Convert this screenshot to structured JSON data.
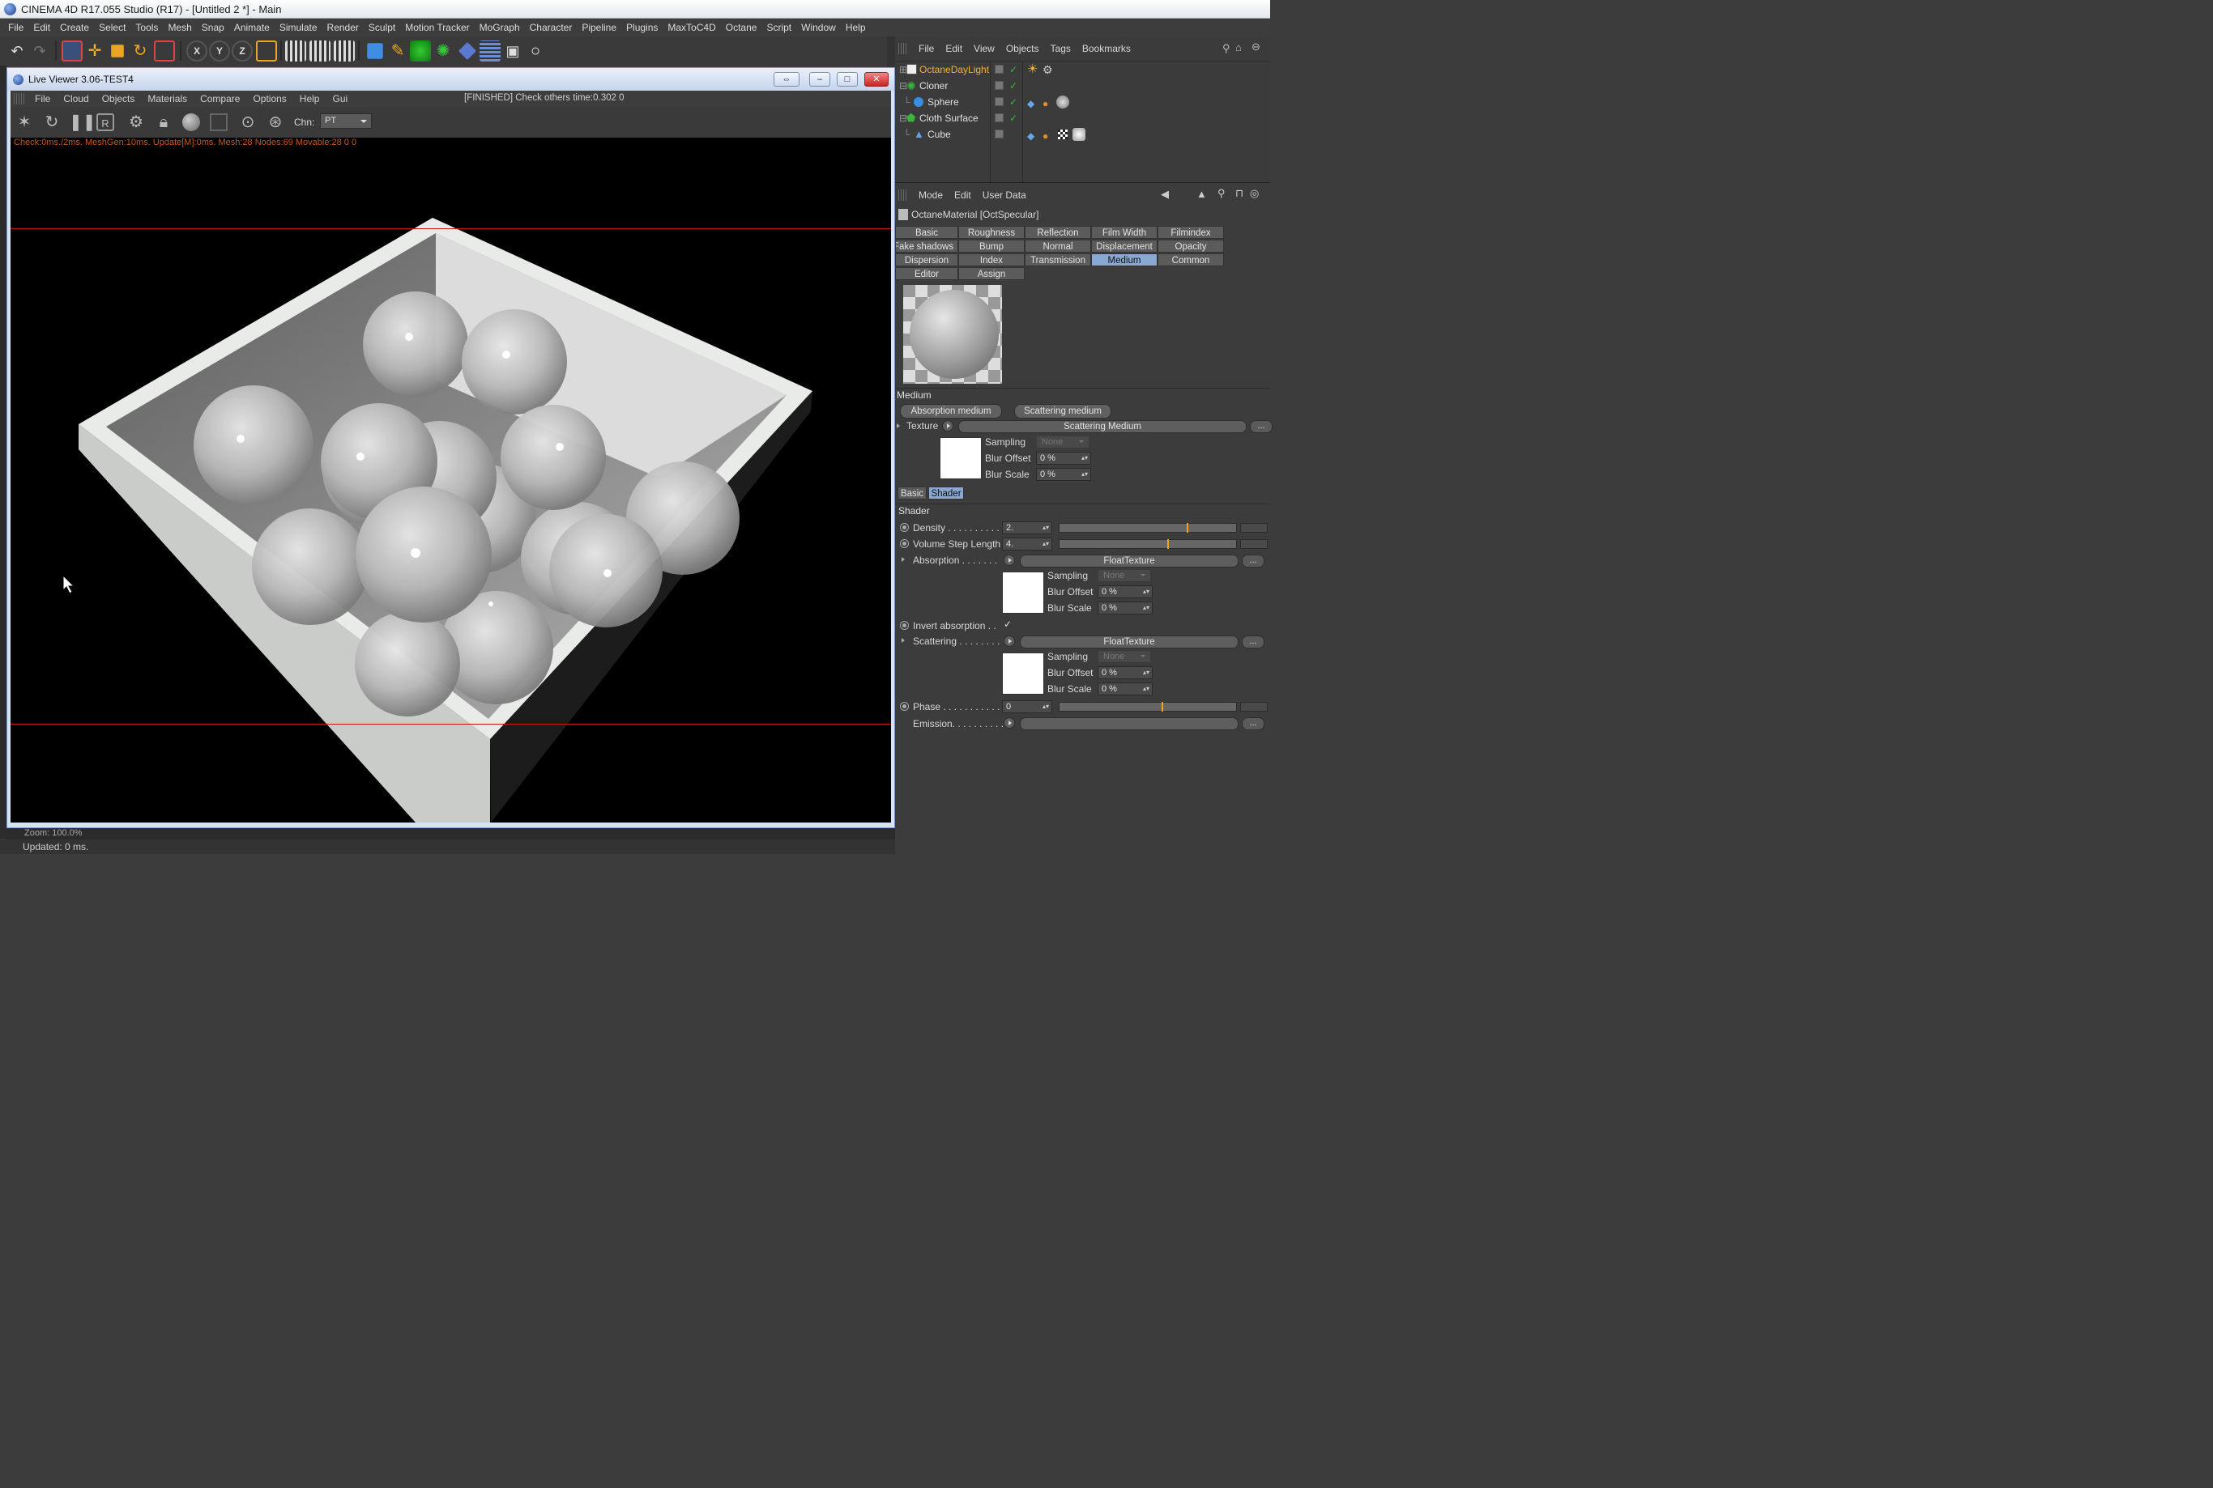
{
  "app": {
    "title": "CINEMA 4D R17.055 Studio (R17) - [Untitled 2 *] - Main",
    "menu": [
      "File",
      "Edit",
      "Create",
      "Select",
      "Tools",
      "Mesh",
      "Snap",
      "Animate",
      "Simulate",
      "Render",
      "Sculpt",
      "Motion Tracker",
      "MoGraph",
      "Character",
      "Pipeline",
      "Plugins",
      "MaxToC4D",
      "Octane",
      "Script",
      "Window",
      "Help"
    ]
  },
  "live_viewer": {
    "title": "Live Viewer 3.06-TEST4",
    "menu": [
      "File",
      "Cloud",
      "Objects",
      "Materials",
      "Compare",
      "Options",
      "Help",
      "Gui"
    ],
    "status": "[FINISHED] Check others time:0.302  0",
    "channel_label": "Chn:",
    "channel_value": "PT",
    "render_info": "Check:0ms./2ms. MeshGen:10ms. Update[M]:0ms. Mesh:28 Nodes:69 Movable:28  0 0",
    "zoom_text": "Zoom: 100.0%"
  },
  "status_bar": {
    "text": "Updated: 0 ms."
  },
  "object_manager": {
    "menu": [
      "File",
      "Edit",
      "View",
      "Objects",
      "Tags",
      "Bookmarks"
    ],
    "objects": [
      {
        "name": "OctaneDayLight",
        "active": true
      },
      {
        "name": "Cloner"
      },
      {
        "name": "Sphere"
      },
      {
        "name": "Cloth Surface"
      },
      {
        "name": "Cube"
      }
    ]
  },
  "attribute_manager": {
    "menu": [
      "Mode",
      "Edit",
      "User Data"
    ],
    "material_title": "OctaneMaterial [OctSpecular]",
    "tabs_row1": [
      "Basic",
      "Roughness",
      "Reflection",
      "Film Width",
      "Filmindex"
    ],
    "tabs_row2": [
      "Fake shadows",
      "Bump",
      "Normal",
      "Displacement",
      "Opacity"
    ],
    "tabs_row3": [
      "Dispersion",
      "Index",
      "Transmission",
      "Medium",
      "Common"
    ],
    "tabs_row4": [
      "Editor",
      "Assign"
    ],
    "selected_tab": "Medium",
    "medium_header": "Medium",
    "absorption_medium_btn": "Absorption medium",
    "scattering_medium_btn": "Scattering medium",
    "texture_label": "Texture",
    "texture_value": "Scattering Medium",
    "ellipsis": "...",
    "sampling_label": "Sampling",
    "sampling_value": "None",
    "blur_offset_label": "Blur Offset",
    "blur_offset_value": "0 %",
    "blur_scale_label": "Blur Scale",
    "blur_scale_value": "0 %",
    "subtabs": [
      "Basic",
      "Shader"
    ],
    "shader_header": "Shader",
    "density_label": "Density . . . . . . . . . .",
    "density_value": "2.",
    "density_slider": 0.72,
    "vsl_label": "Volume Step Length",
    "vsl_value": "4.",
    "vsl_slider": 0.61,
    "absorption_label": "Absorption . . . . . . .",
    "absorption_value": "FloatTexture",
    "invert_label": "Invert absorption . .",
    "invert_check": "✓",
    "scattering_label": "Scattering . . . . . . . .",
    "scattering_value": "FloatTexture",
    "phase_label": "Phase . . . . . . . . . . . . .",
    "phase_value": "0",
    "phase_slider": 0.58,
    "emission_label": "Emission. . . . . . . . . . ."
  }
}
